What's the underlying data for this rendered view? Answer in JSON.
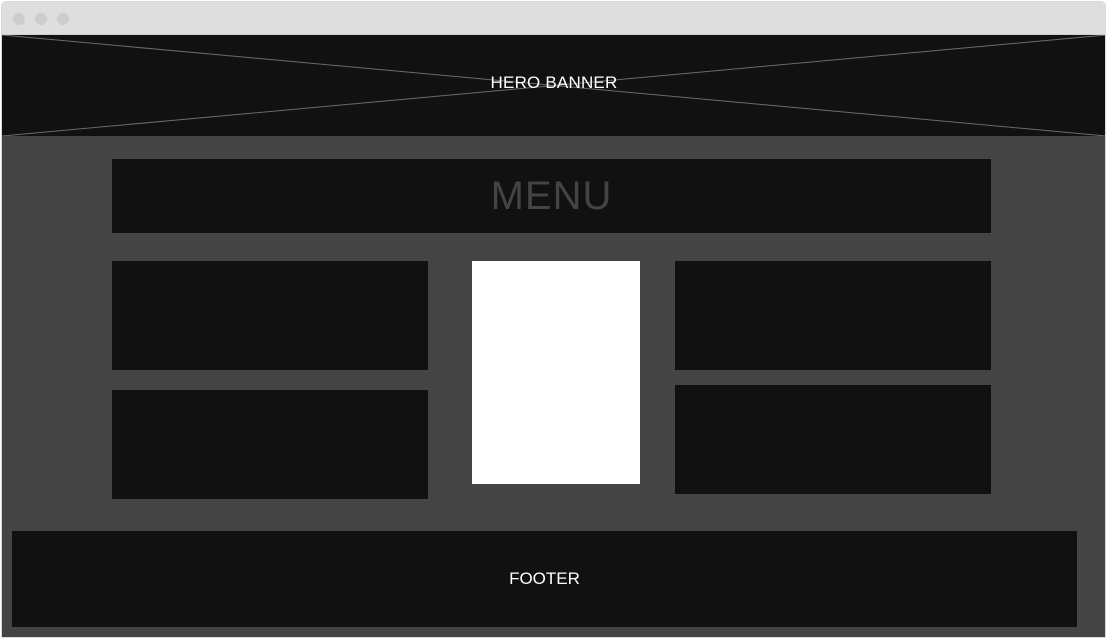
{
  "window": {
    "controls": [
      "close",
      "minimize",
      "maximize"
    ]
  },
  "hero": {
    "label": "HERO BANNER"
  },
  "menu": {
    "label": "MENU"
  },
  "footer": {
    "label": "FOOTER"
  },
  "colors": {
    "background": "#444444",
    "block": "#111111",
    "image_placeholder": "#ffffff",
    "titlebar": "#dedede",
    "menu_text": "#444444",
    "label_text": "#ffffff"
  }
}
